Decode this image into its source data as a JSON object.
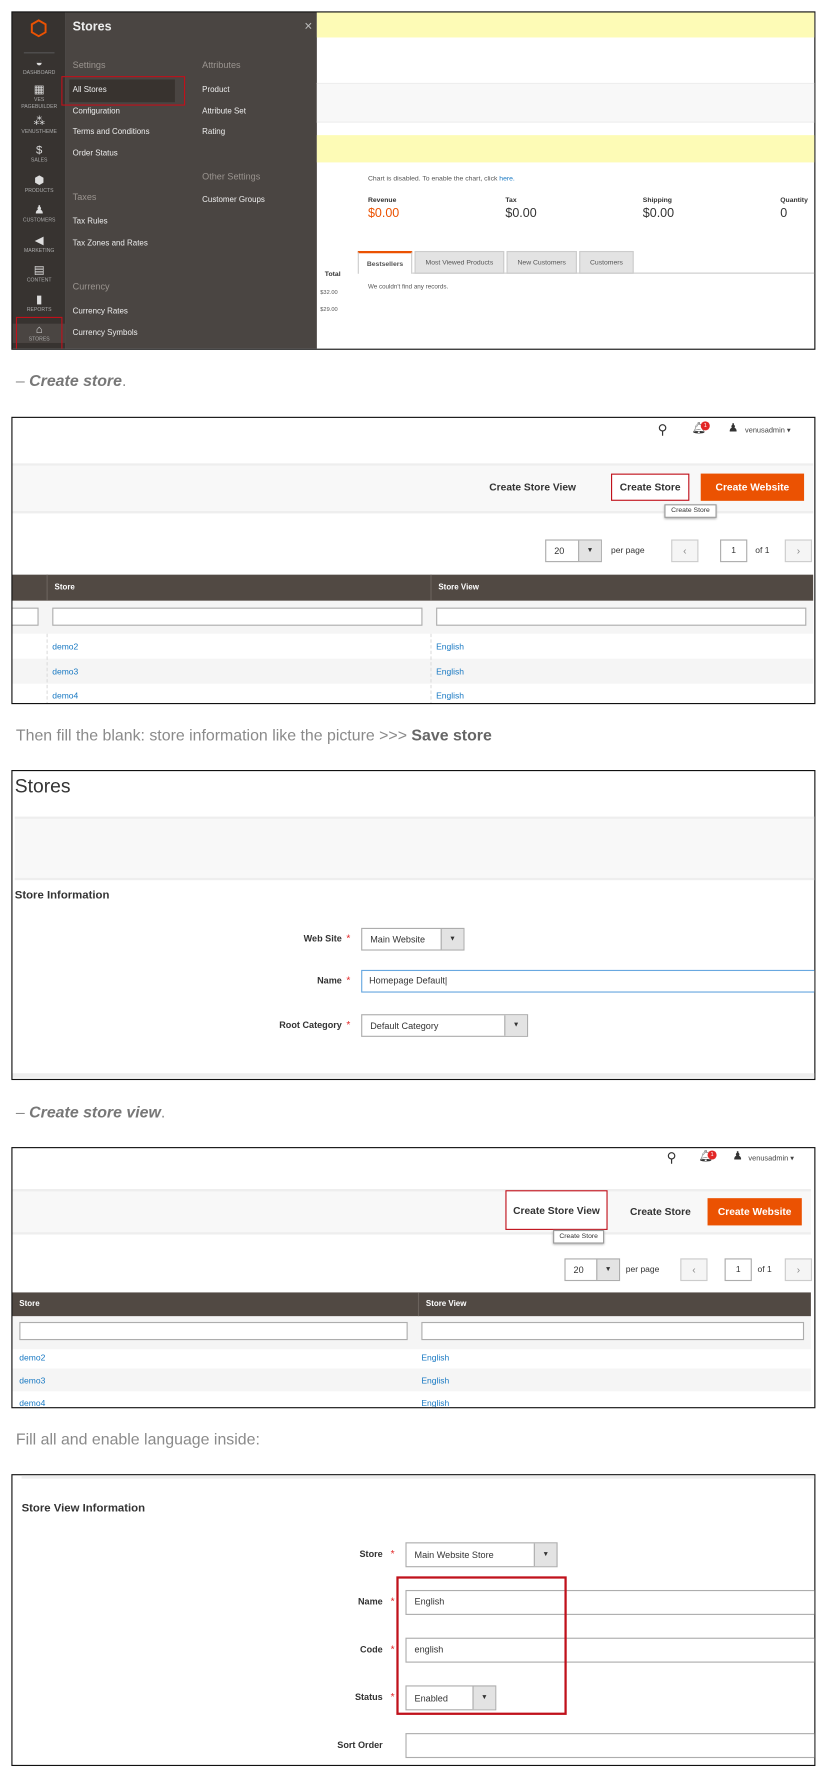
{
  "panel1": {
    "menu_title": "Stores",
    "close": "×",
    "rail": [
      {
        "icon": "dashboard-icon",
        "glyph": "◒",
        "label": "DASHBOARD"
      },
      {
        "icon": "pagebuilder-icon",
        "glyph": "▦",
        "label": "VES PAGEBUILDER"
      },
      {
        "icon": "venustheme-icon",
        "glyph": "⁂",
        "label": "VENUSTHEME"
      },
      {
        "icon": "sales-icon",
        "glyph": "$",
        "label": "SALES"
      },
      {
        "icon": "products-icon",
        "glyph": "⬢",
        "label": "PRODUCTS"
      },
      {
        "icon": "customers-icon",
        "glyph": "♟",
        "label": "CUSTOMERS"
      },
      {
        "icon": "marketing-icon",
        "glyph": "◀",
        "label": "MARKETING"
      },
      {
        "icon": "content-icon",
        "glyph": "▤",
        "label": "CONTENT"
      },
      {
        "icon": "reports-icon",
        "glyph": "▮",
        "label": "REPORTS"
      },
      {
        "icon": "stores-icon",
        "glyph": "⌂",
        "label": "STORES"
      }
    ],
    "settings": {
      "heading": "Settings",
      "items": [
        "All Stores",
        "Configuration",
        "Terms and Conditions",
        "Order Status"
      ]
    },
    "taxes": {
      "heading": "Taxes",
      "items": [
        "Tax Rules",
        "Tax Zones and Rates"
      ]
    },
    "currency": {
      "heading": "Currency",
      "items": [
        "Currency Rates",
        "Currency Symbols"
      ]
    },
    "attributes": {
      "heading": "Attributes",
      "items": [
        "Product",
        "Attribute Set",
        "Rating"
      ]
    },
    "other": {
      "heading": "Other Settings",
      "items": [
        "Customer Groups"
      ]
    },
    "chart_note": "Chart is disabled. To enable the chart, click ",
    "chart_link": "here.",
    "stats": [
      {
        "label": "Revenue",
        "value": "$0.00"
      },
      {
        "label": "Tax",
        "value": "$0.00"
      },
      {
        "label": "Shipping",
        "value": "$0.00"
      },
      {
        "label": "Quantity",
        "value": "0"
      }
    ],
    "total_header": "Total",
    "totals": [
      "$32.00",
      "$29.00"
    ],
    "tabs": [
      "Bestsellers",
      "Most Viewed Products",
      "New Customers",
      "Customers"
    ],
    "empty": "We couldn't find any records.",
    "accent": "#eb5202"
  },
  "captions": {
    "c1_dash": "– ",
    "c1_bold": "Create store",
    "c1_end": ".",
    "c2_text": "Then fill the blank: store information like the picture >>> ",
    "c2_bold": "Save store",
    "c3_dash": "– ",
    "c3_bold": "Create store view",
    "c3_end": ".",
    "c4_text": "Fill all and enable language inside:"
  },
  "grid": {
    "user": "venusadmin",
    "notif_count": "1",
    "create_store_view": "Create Store View",
    "create_store": "Create Store",
    "create_website": "Create Website",
    "tooltip": "Create Store",
    "per_page_value": "20",
    "per_page_label": "per page",
    "page": "1",
    "of_pages": "of 1",
    "columns": [
      "Store",
      "Store View"
    ],
    "rows": [
      [
        "demo2",
        "English"
      ],
      [
        "demo3",
        "English"
      ],
      [
        "demo4",
        "English"
      ]
    ]
  },
  "store_form": {
    "title": "Stores",
    "section": "Store Information",
    "website_label": "Web Site",
    "website_value": "Main Website",
    "name_label": "Name",
    "name_value": "Homepage Default",
    "root_label": "Root Category",
    "root_value": "Default Category"
  },
  "view_form": {
    "section": "Store View Information",
    "store_label": "Store",
    "store_value": "Main Website Store",
    "name_label": "Name",
    "name_value": "English",
    "code_label": "Code",
    "code_value": "english",
    "status_label": "Status",
    "status_value": "Enabled",
    "sort_label": "Sort Order",
    "sort_value": ""
  }
}
